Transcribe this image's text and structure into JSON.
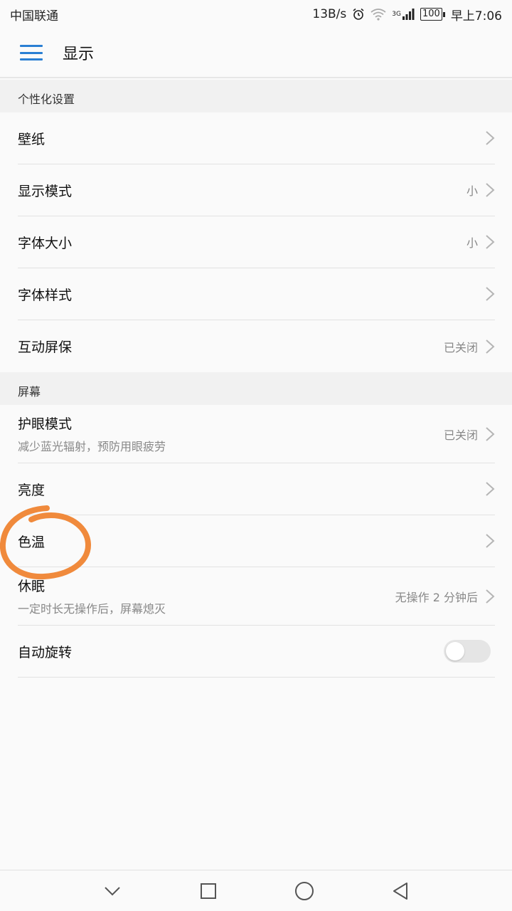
{
  "status_bar": {
    "carrier": "中国联通",
    "speed": "13B/s",
    "network": "3G",
    "battery": "100",
    "time": "早上7:06",
    "icons": [
      "alarm-icon",
      "wifi-icon",
      "signal-icon",
      "battery-icon"
    ]
  },
  "toolbar": {
    "title": "显示",
    "menu_icon": "hamburger-menu-icon",
    "accent_color": "#2a7fd3"
  },
  "sections": [
    {
      "header": "个性化设置",
      "items": [
        {
          "label": "壁纸",
          "value": ""
        },
        {
          "label": "显示模式",
          "value": "小"
        },
        {
          "label": "字体大小",
          "value": "小"
        },
        {
          "label": "字体样式",
          "value": ""
        },
        {
          "label": "互动屏保",
          "value": "已关闭"
        }
      ]
    },
    {
      "header": "屏幕",
      "items": [
        {
          "label": "护眼模式",
          "sublabel": "减少蓝光辐射，预防用眼疲劳",
          "value": "已关闭"
        },
        {
          "label": "亮度",
          "value": ""
        },
        {
          "label": "色温",
          "value": ""
        },
        {
          "label": "休眠",
          "sublabel": "一定时长无操作后，屏幕熄灭",
          "value": "无操作 2 分钟后"
        },
        {
          "label": "自动旋转",
          "toggle": false
        }
      ]
    }
  ],
  "nav_bar": {
    "icons": [
      "down-chevron-icon",
      "recent-apps-icon",
      "home-icon",
      "back-icon"
    ]
  },
  "annotation_color": "#f08a3c"
}
